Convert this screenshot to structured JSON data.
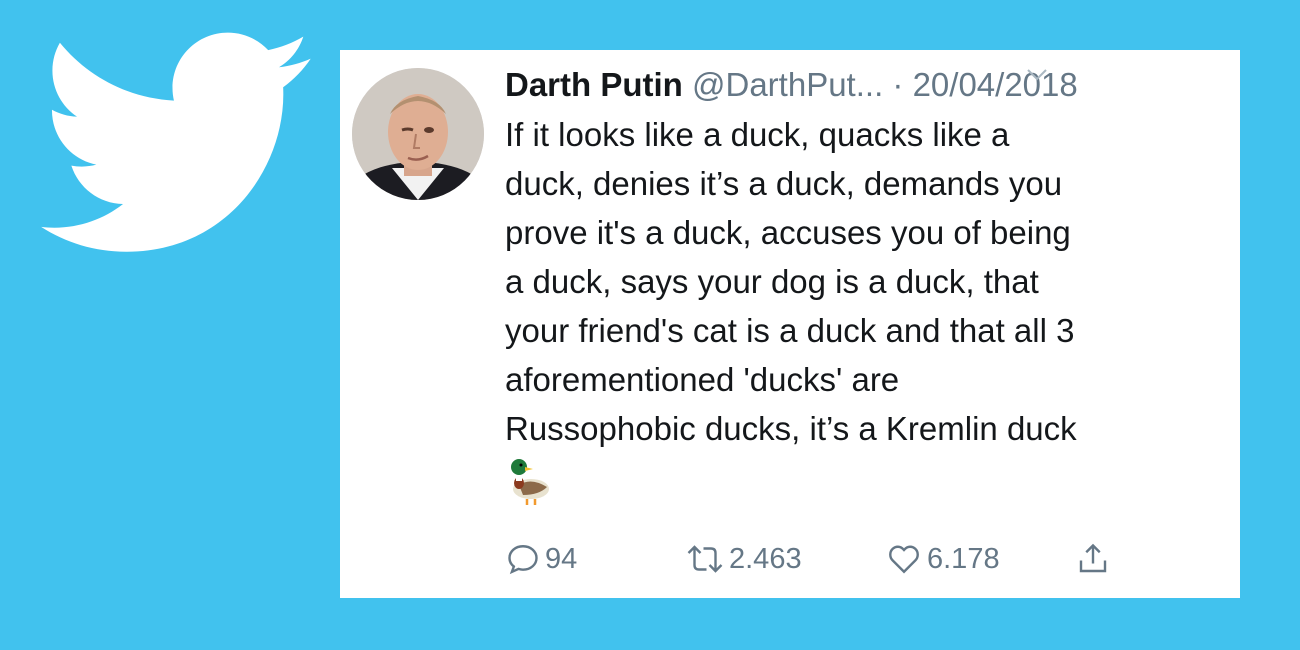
{
  "background_color": "#41c2ee",
  "logo": {
    "icon": "twitter-bird-icon",
    "color": "#ffffff"
  },
  "tweet": {
    "avatar_icon": "user-avatar-photo",
    "display_name": "Darth Putin",
    "handle": "@DarthPut...",
    "separator": "·",
    "date": "20/04/2018",
    "menu_icon": "chevron-down-icon",
    "text_lines": [
      "If it looks like a duck, quacks like a",
      "duck, denies it’s a duck, demands you",
      "prove it's a duck, accuses you of being",
      "a duck, says your dog is a duck, that",
      "your friend's cat is a duck and that all 3",
      "aforementioned 'ducks' are",
      "Russophobic ducks, it’s a Kremlin duck"
    ],
    "emoji": "duck-emoji",
    "actions": {
      "reply": {
        "icon": "reply-icon",
        "count": "94"
      },
      "retweet": {
        "icon": "retweet-icon",
        "count": "2.463"
      },
      "like": {
        "icon": "heart-icon",
        "count": "6.178"
      },
      "share": {
        "icon": "share-icon"
      }
    },
    "text_color": "#14171a",
    "muted_color": "#657786"
  }
}
